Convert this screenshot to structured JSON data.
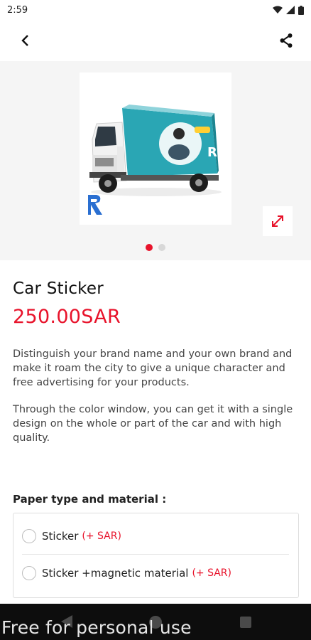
{
  "status_bar": {
    "time": "2:59"
  },
  "product": {
    "title": "Car Sticker",
    "price": "250.00SAR",
    "description_1": "Distinguish your brand name and your own brand and make it roam the city to give a unique character and free advertising for your products.",
    "description_2": "Through the color window, you can get it with a single design on the whole or part of the car and with high quality."
  },
  "gallery": {
    "image_count": 2,
    "active_index": 0
  },
  "options": {
    "heading": "Paper type and material :",
    "items": [
      {
        "label": "Sticker",
        "price": "(+ SAR)"
      },
      {
        "label": "Sticker +magnetic material",
        "price": "(+ SAR)"
      }
    ]
  },
  "watermark": "Free for personal use",
  "colors": {
    "accent": "#e8132b",
    "truck_box": "#2aa6b4"
  }
}
